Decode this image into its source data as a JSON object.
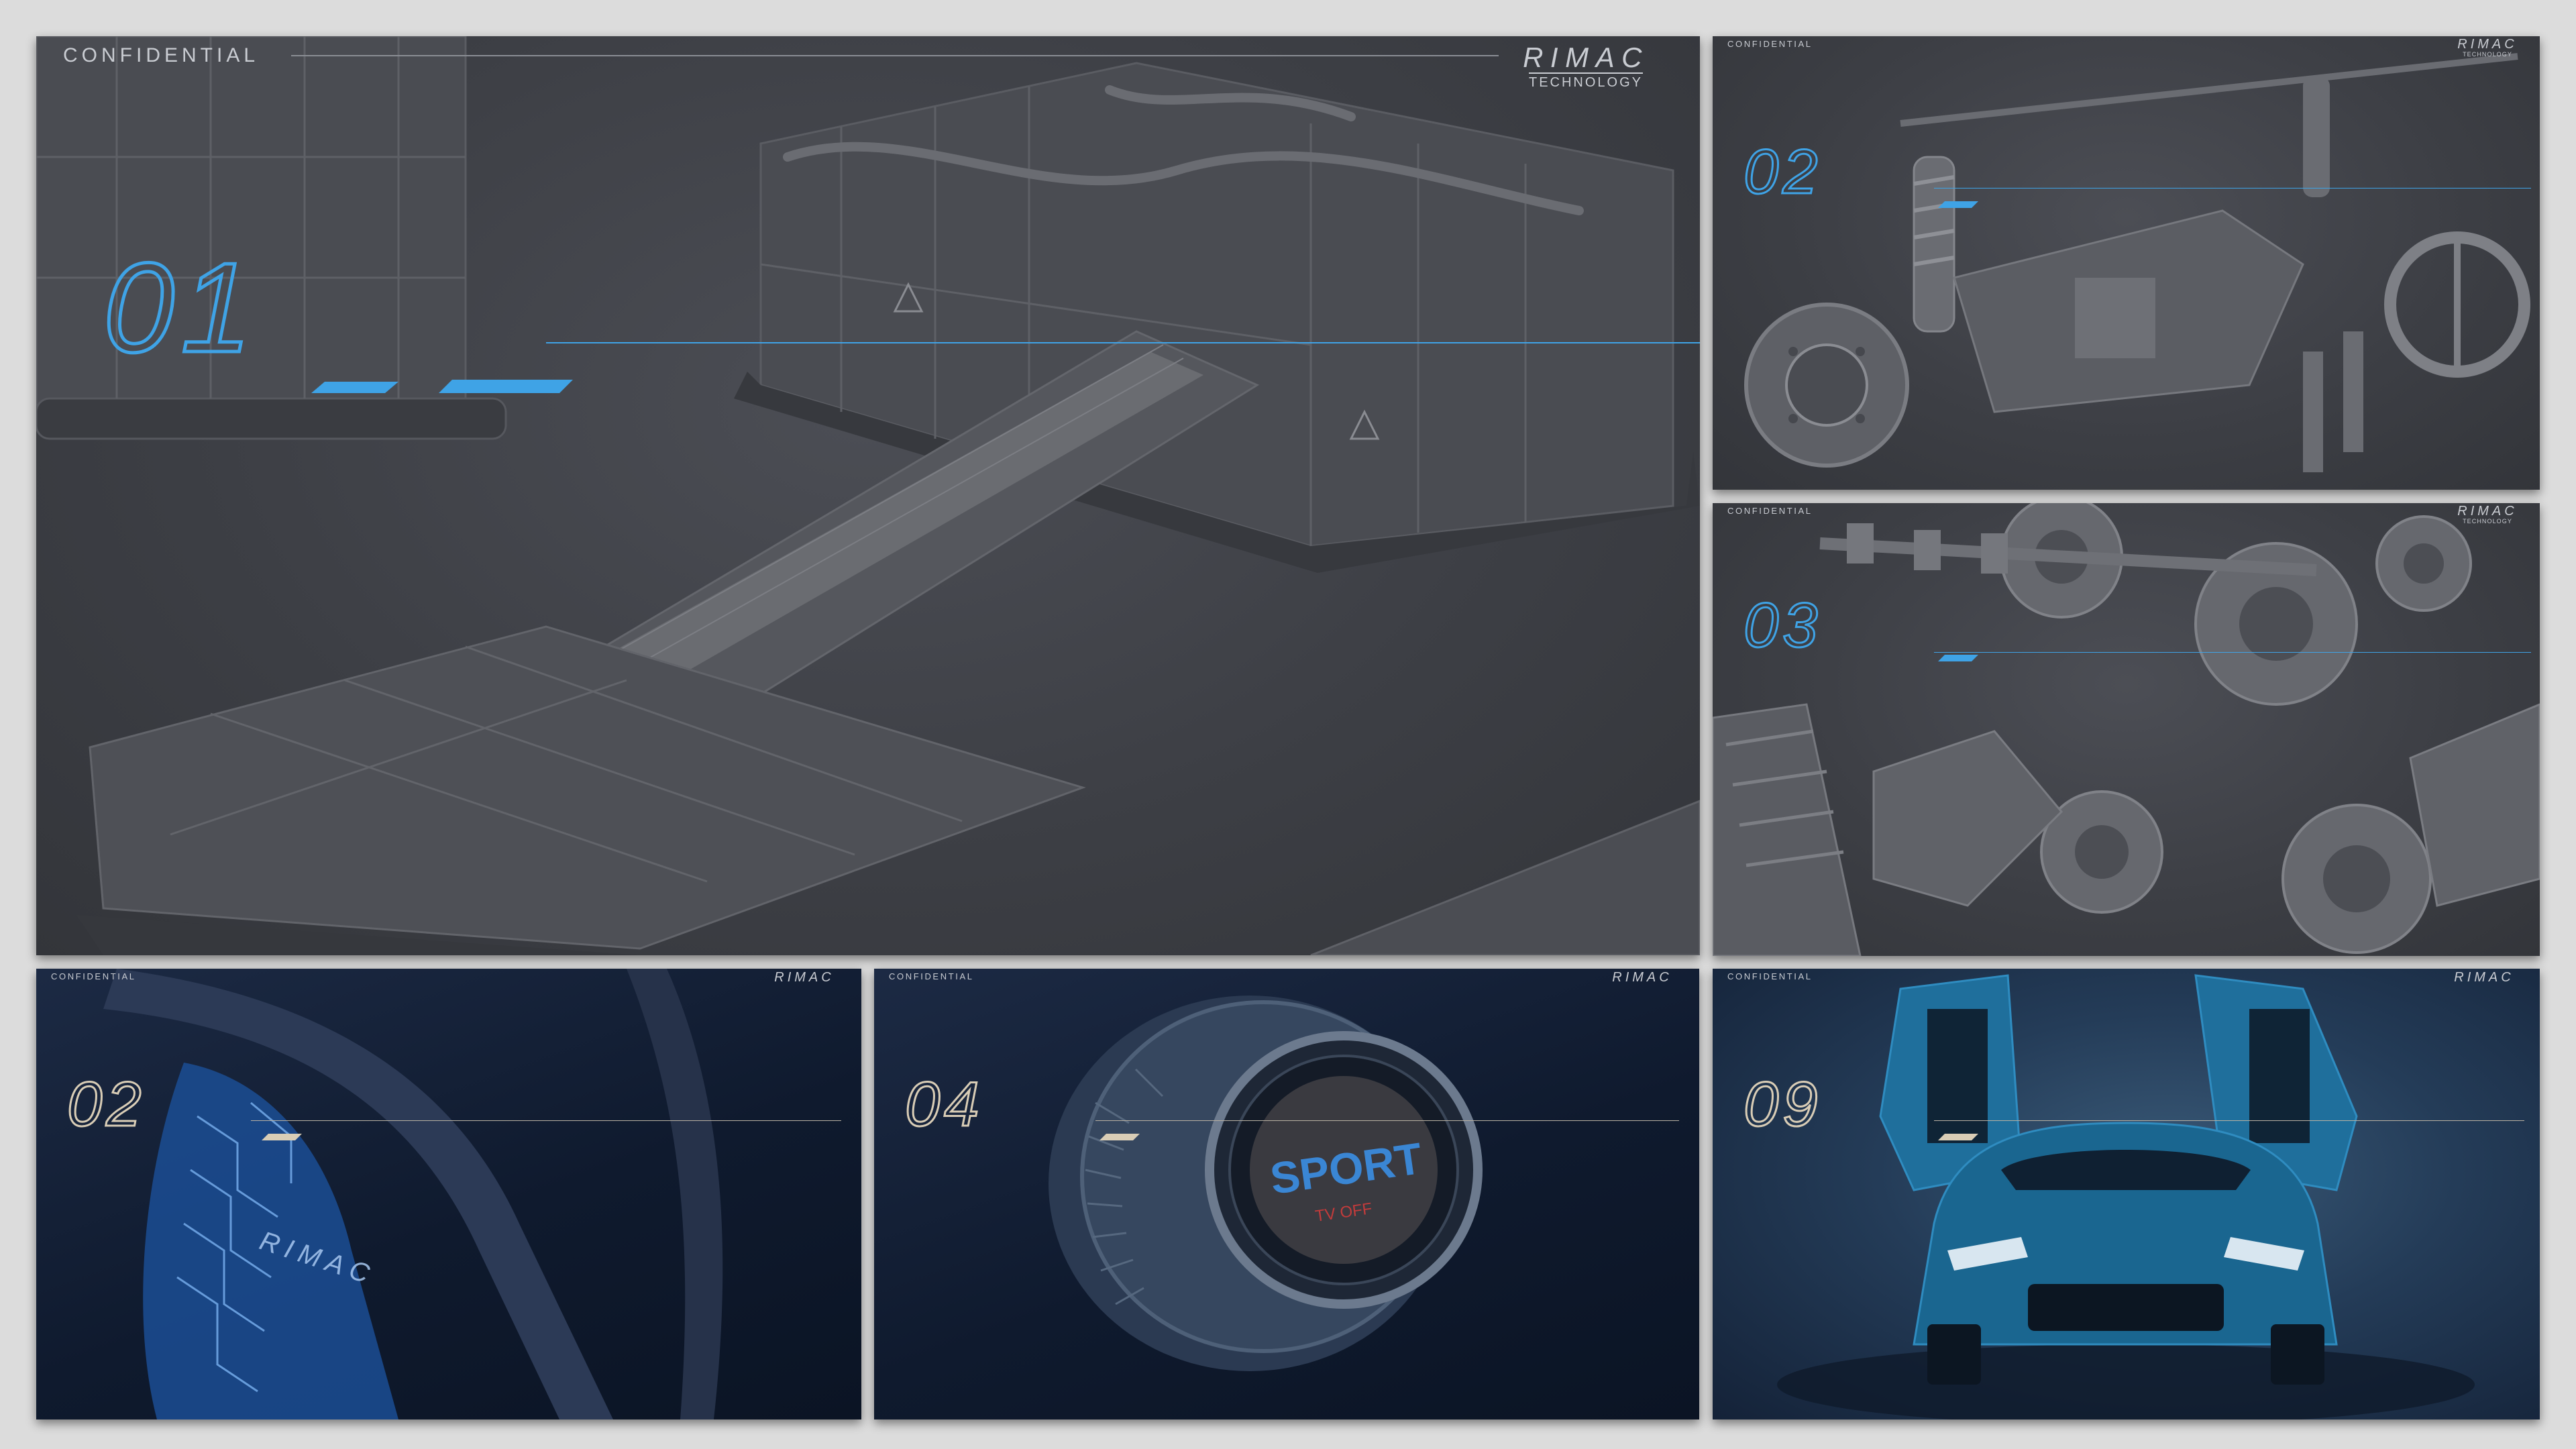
{
  "colors": {
    "accent_blue": "#3fa3e6",
    "accent_sand": "#d9cdb6",
    "tech_bg": "#3f4147",
    "navy_bg": "#111c30",
    "car_blue": "#1f6f9c"
  },
  "slides": [
    {
      "confidential": "CONFIDENTIAL",
      "logo": "RIMAC",
      "logo_sub": "TECHNOLOGY",
      "number": "01",
      "subject": "battery-pack"
    },
    {
      "confidential": "CONFIDENTIAL",
      "logo": "RIMAC",
      "logo_sub": "TECHNOLOGY",
      "number": "02",
      "subject": "suspension-chassis"
    },
    {
      "confidential": "CONFIDENTIAL",
      "logo": "RIMAC",
      "logo_sub": "TECHNOLOGY",
      "number": "03",
      "subject": "gearbox-drivetrain"
    },
    {
      "confidential": "CONFIDENTIAL",
      "logo": "RIMAC",
      "number": "02",
      "subject": "steering-wheel-closeup",
      "embossed": "RIMAC"
    },
    {
      "confidential": "CONFIDENTIAL",
      "logo": "RIMAC",
      "number": "04",
      "subject": "drive-mode-knob",
      "knob_label": "SPORT",
      "knob_sub": "TV OFF"
    },
    {
      "confidential": "CONFIDENTIAL",
      "logo": "RIMAC",
      "number": "09",
      "subject": "hypercar-front"
    }
  ]
}
